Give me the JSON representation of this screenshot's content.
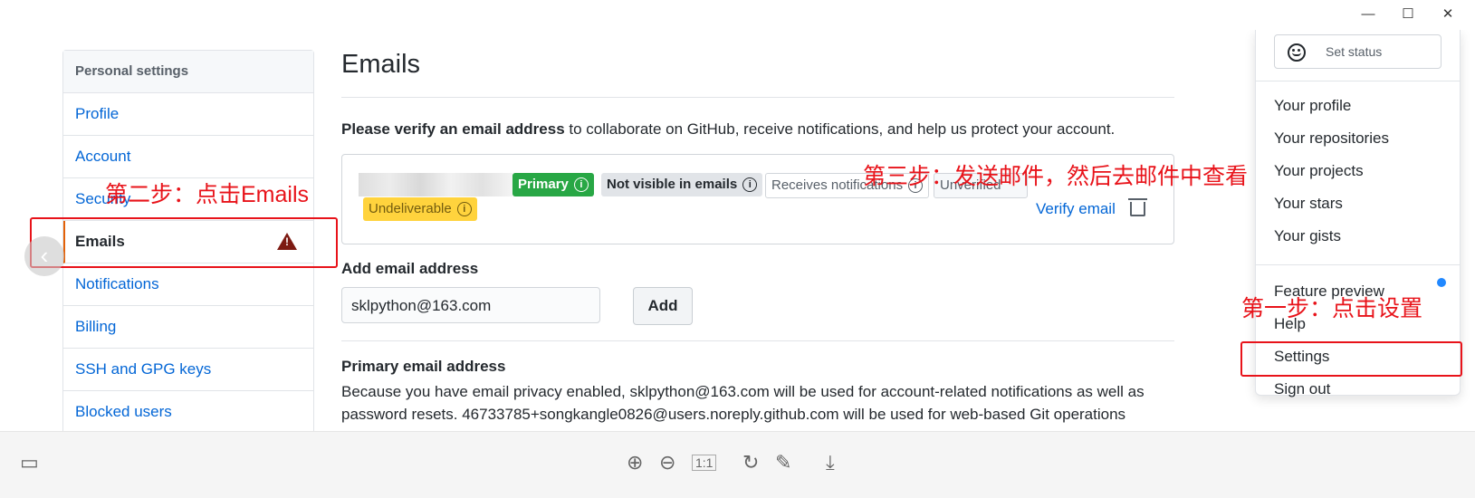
{
  "window": {
    "minimize": "—",
    "maximize": "☐",
    "close": "✕"
  },
  "sidebar": {
    "header": "Personal settings",
    "items": [
      {
        "label": "Profile"
      },
      {
        "label": "Account"
      },
      {
        "label": "Security"
      },
      {
        "label": "Emails"
      },
      {
        "label": "Notifications"
      },
      {
        "label": "Billing"
      },
      {
        "label": "SSH and GPG keys"
      },
      {
        "label": "Blocked users"
      }
    ],
    "selected": "Emails"
  },
  "main": {
    "title": "Emails",
    "verify_bold": "Please verify an email address",
    "verify_rest": " to collaborate on GitHub, receive notifications, and help us protect your account.",
    "email_entry": {
      "labels": {
        "primary": "Primary",
        "not_visible": "Not visible in emails",
        "receives": "Receives notifications",
        "unverified": "Unverified",
        "undeliverable": "Undeliverable"
      },
      "verify_link": "Verify email"
    },
    "add_email": {
      "title": "Add email address",
      "input_value": "sklpython@163.com",
      "button": "Add"
    },
    "primary_email": {
      "title": "Primary email address",
      "desc": "Because you have email privacy enabled, sklpython@163.com will be used for account-related notifications as well as password resets. 46733785+songkangle0826@users.noreply.github.com will be used for web-based Git operations"
    }
  },
  "dropdown": {
    "set_status": "Set status",
    "items": [
      "Your profile",
      "Your repositories",
      "Your projects",
      "Your stars",
      "Your gists",
      "Feature preview",
      "Help",
      "Settings",
      "Sign out"
    ]
  },
  "annotations": {
    "step1": "第一步：点击设置",
    "step2": "第二步：点击Emails",
    "step3": "第三步：发送邮件，然后去邮件中查看"
  },
  "toolbar": {
    "icons": [
      "thumbnail-icon",
      "zoom-in-icon",
      "zoom-out-icon",
      "actual-size-icon",
      "rotate-icon",
      "edit-icon",
      "download-icon"
    ]
  }
}
